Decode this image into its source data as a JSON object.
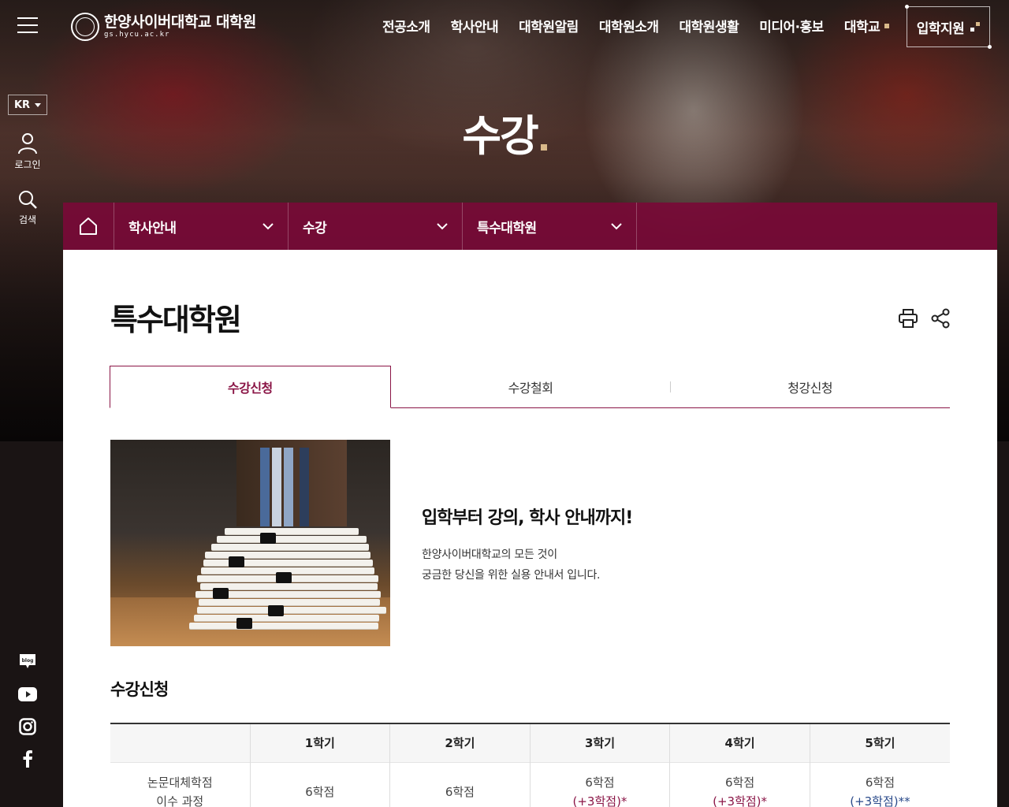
{
  "header": {
    "logo_name": "한양사이버대학교 대학원",
    "logo_url": "gs.hycu.ac.kr",
    "nav": [
      "전공소개",
      "학사안내",
      "대학원알림",
      "대학원소개",
      "대학원생활",
      "미디어·홍보",
      "대학교"
    ],
    "admission_label": "입학지원"
  },
  "rail": {
    "lang": "KR",
    "login_label": "로그인",
    "search_label": "검색",
    "social": [
      "blog-icon",
      "youtube-icon",
      "instagram-icon",
      "facebook-icon"
    ]
  },
  "hero": {
    "title": "수강"
  },
  "breadcrumb": [
    "학사안내",
    "수강",
    "특수대학원"
  ],
  "page": {
    "title": "특수대학원",
    "tabs": [
      "수강신청",
      "수강철회",
      "청강신청"
    ],
    "active_tab": 0,
    "intro_heading": "입학부터 강의, 학사 안내까지!",
    "intro_line1": "한양사이버대학교의 모든 것이",
    "intro_line2": "궁금한 당신을 위한 실용 안내서 입니다.",
    "section_title": "수강신청"
  },
  "table": {
    "headers": [
      "",
      "1학기",
      "2학기",
      "3학기",
      "4학기",
      "5학기"
    ],
    "row1": {
      "label": "논문대체학점 이수 과정",
      "cells": [
        "6학점",
        "6학점",
        "6학점",
        "6학점",
        "6학점"
      ],
      "extra": [
        "",
        "",
        "(+3학점)*",
        "(+3학점)*",
        "(+3학점)**"
      ]
    }
  },
  "colors": {
    "accent": "#8a1546",
    "gold": "#d9b98a",
    "blue": "#2a4a8a"
  }
}
